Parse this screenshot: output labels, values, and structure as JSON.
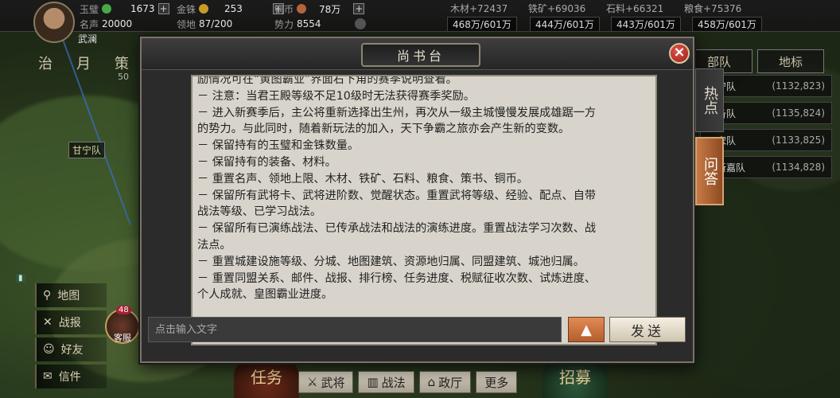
{
  "topbar": {
    "resources": [
      {
        "name": "玉璧",
        "value": "1673",
        "color": "#46a84a"
      },
      {
        "name": "金铢",
        "value": "253",
        "color": "#c79a2a"
      },
      {
        "name": "铜币",
        "value": "78万",
        "color": "#b5643a"
      }
    ],
    "fame_label": "名声",
    "fame_value": "20000",
    "territory_label": "领地",
    "territory_value": "87/200",
    "power_label": "势力",
    "power_value": "8554",
    "faction": "武澜",
    "goods": [
      {
        "label": "木材+72437",
        "stock": "468万/601万"
      },
      {
        "label": "铁矿+69036",
        "stock": "444万/601万"
      },
      {
        "label": "石料+66321",
        "stock": "443万/601万"
      },
      {
        "label": "粮食+75376",
        "stock": "458万/601万"
      }
    ]
  },
  "left": {
    "tabs": [
      "治",
      "月",
      "策"
    ],
    "troop_badge": "甘宁队",
    "counter": "50",
    "menu": [
      {
        "label": "地图",
        "icon": "map-pin-icon"
      },
      {
        "label": "战报",
        "icon": "crossed-swords-icon"
      },
      {
        "label": "好友",
        "icon": "friends-icon"
      },
      {
        "label": "信件",
        "icon": "mail-icon"
      }
    ],
    "kefu": "客服",
    "kefu_count": "48"
  },
  "right": {
    "tabs": [
      "部队",
      "地标"
    ],
    "queues": [
      {
        "name": "…守队",
        "coord": "(1132,823)"
      },
      {
        "name": "…备队",
        "coord": "(1135,824)"
      },
      {
        "name": "…宋队",
        "coord": "(1133,825)"
      },
      {
        "name": "…新嘉队",
        "coord": "(1134,828)"
      }
    ]
  },
  "bottom": {
    "task": "任务",
    "recruit": "招募",
    "nav": [
      "武将",
      "战法",
      "政厅",
      "更多"
    ]
  },
  "modal": {
    "title": "尚书台",
    "close": "×",
    "side_tabs": [
      "热点",
      "问答"
    ],
    "lines": [
      "励情况可在“黄图霸业”界面右下角的赛季说明查看。",
      "－ 注意：当君王殿等级不足10级时无法获得赛季奖励。",
      "－ 进入新赛季后，主公将重新选择出生州，再次从一级主城慢慢发展成雄踞一方",
      "的势力。与此同时，随着新玩法的加入，天下争霸之旅亦会产生新的变数。",
      "－ 保留持有的玉璧和金铢数量。",
      "－ 保留持有的装备、材料。",
      "－ 重置名声、领地上限、木材、铁矿、石料、粮食、策书、铜币。",
      "－ 保留所有武将卡、武将进阶数、觉醒状态。重置武将等级、经验、配点、自带",
      "战法等级、已学习战法。",
      "－ 保留所有已演练战法、已传承战法和战法的演练进度。重置战法学习次数、战",
      "法点。",
      "－ 重置城建设施等级、分城、地图建筑、资源地归属、同盟建筑、城池归属。",
      "－ 重置同盟关系、邮件、战报、排行榜、任务进度、税赋征收次数、试炼进度、",
      "个人成就、皇图霸业进度。"
    ],
    "input_placeholder": "点击输入文字",
    "up_icon": "▲",
    "send_label": "发送"
  }
}
